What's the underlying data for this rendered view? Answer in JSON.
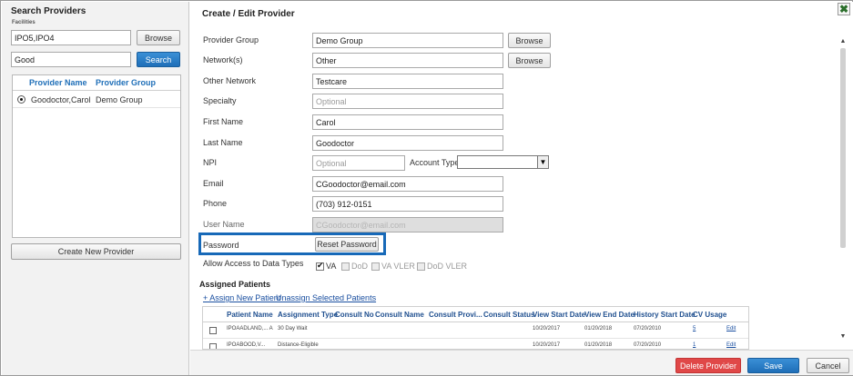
{
  "search": {
    "title": "Search Providers",
    "facilities_label": "Facilities",
    "facilities_value": "IPO5,IPO4",
    "browse_label": "Browse",
    "query_value": "Good",
    "search_label": "Search",
    "columns": [
      "Provider Name",
      "Provider Group"
    ],
    "results": [
      {
        "name": "Goodoctor,Carol",
        "group": "Demo Group",
        "selected": true
      }
    ],
    "create_label": "Create New Provider"
  },
  "editor": {
    "title": "Create / Edit Provider",
    "close_glyph": "✖",
    "browse_label": "Browse",
    "fields": {
      "provider_group": {
        "label": "Provider Group",
        "value": "Demo Group"
      },
      "networks": {
        "label": "Network(s)",
        "value": "Other"
      },
      "other_network": {
        "label": "Other Network",
        "value": "Testcare"
      },
      "specialty": {
        "label": "Specialty",
        "placeholder": "Optional"
      },
      "first_name": {
        "label": "First Name",
        "value": "Carol"
      },
      "last_name": {
        "label": "Last Name",
        "value": "Goodoctor"
      },
      "npi": {
        "label": "NPI",
        "placeholder": "Optional"
      },
      "account_type": {
        "label": "Account Type",
        "value": ""
      },
      "email": {
        "label": "Email",
        "value": "CGoodoctor@email.com"
      },
      "phone": {
        "label": "Phone",
        "value": "(703) 912-0151"
      },
      "user_name": {
        "label": "User Name",
        "value": "CGoodoctor@email.com"
      },
      "password": {
        "label": "Password",
        "reset_label": "Reset Password"
      }
    },
    "access": {
      "label": "Allow Access to Data Types",
      "options": [
        {
          "label": "VA",
          "checked": true,
          "enabled": true
        },
        {
          "label": "DoD",
          "checked": false,
          "enabled": false
        },
        {
          "label": "VA VLER",
          "checked": false,
          "enabled": false
        },
        {
          "label": "DoD VLER",
          "checked": false,
          "enabled": false
        }
      ]
    },
    "assigned": {
      "title": "Assigned Patients",
      "assign_link": "+ Assign New Patient",
      "unassign_link": "Unassign Selected Patients",
      "columns": [
        "Patient Name",
        "Assignment Type",
        "Consult No",
        "Consult Name",
        "Consult Provi...",
        "Consult Status",
        "View Start Date",
        "View End Date",
        "History Start Date",
        "CV Usage"
      ],
      "rows": [
        {
          "patient": "IPOAADLAND,... A",
          "type": "30 Day Wait",
          "view_start": "10/20/2017",
          "view_end": "01/20/2018",
          "history_start": "07/20/2010",
          "cv_usage": "5",
          "edit": "Edit"
        },
        {
          "patient": "IPOABOOD,V...",
          "type": "Distance-Eligible",
          "view_start": "10/20/2017",
          "view_end": "01/20/2018",
          "history_start": "07/20/2010",
          "cv_usage": "1",
          "edit": "Edit"
        }
      ]
    },
    "footer": {
      "delete_label": "Delete Provider",
      "save_label": "Save",
      "cancel_label": "Cancel"
    }
  },
  "colors": {
    "primary_blue": "#1f6fb8",
    "delete_red": "#e04848",
    "highlight_blue": "#1769b8",
    "link_blue": "#1a4fa0"
  }
}
